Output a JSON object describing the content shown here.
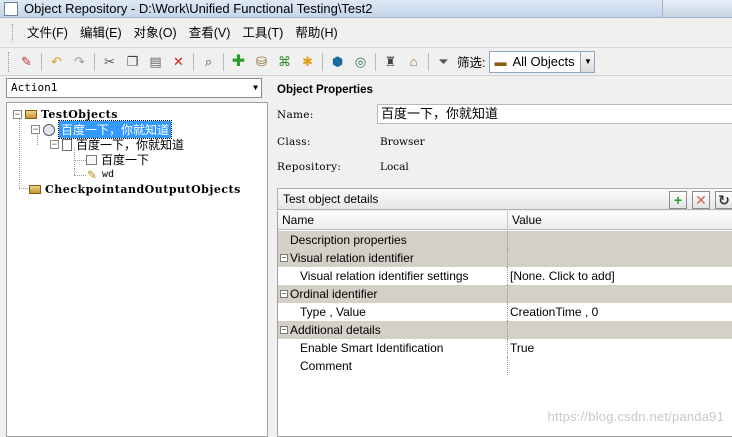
{
  "window": {
    "title": "Object Repository - D:\\Work\\Unified Functional Testing\\Test2"
  },
  "menu": {
    "items": [
      "文件(F)",
      "编辑(E)",
      "对象(O)",
      "查看(V)",
      "工具(T)",
      "帮助(H)"
    ]
  },
  "toolbar": {
    "icons": [
      "locate-icon",
      "undo-icon",
      "redo-icon",
      "cut-icon",
      "copy-icon",
      "paste-icon",
      "delete-icon",
      "find-icon",
      "add-object-icon",
      "add-objects-icon",
      "navigate-learn-icon",
      "highlight-icon",
      "object-spy-icon",
      "define-object-icon",
      "checkpoint-icon",
      "recovery-icon"
    ],
    "filter_label": "筛选:",
    "filter_value": "All Objects"
  },
  "action": {
    "selected": "Action1"
  },
  "tree": {
    "root_label": "TestObjects",
    "browser_label": "百度一下，你就知道",
    "page_label": "百度一下，你就知道",
    "button_label": "百度一下",
    "edit_label": "wd",
    "checkpoints_label": "CheckpointandOutputObjects"
  },
  "properties": {
    "title": "Object Properties",
    "name_label": "Name:",
    "name_value": "百度一下，你就知道",
    "class_label": "Class:",
    "class_value": "Browser",
    "repository_label": "Repository:",
    "repository_value": "Local"
  },
  "details": {
    "title": "Test object details",
    "columns": [
      "Name",
      "Value"
    ],
    "rows": [
      {
        "name": "Description properties",
        "value": "",
        "category": true,
        "expander": ""
      },
      {
        "name": "Visual relation identifier",
        "value": "",
        "category": true,
        "expander": "−"
      },
      {
        "name": "Visual relation identifier settings",
        "value": "[None. Click to add]",
        "category": false,
        "expander": ""
      },
      {
        "name": "Ordinal identifier",
        "value": "",
        "category": true,
        "expander": "−"
      },
      {
        "name": "Type , Value",
        "value": "CreationTime , 0",
        "category": false,
        "expander": ""
      },
      {
        "name": "Additional details",
        "value": "",
        "category": true,
        "expander": "−"
      },
      {
        "name": "Enable Smart Identification",
        "value": "True",
        "category": false,
        "expander": ""
      },
      {
        "name": "Comment",
        "value": "",
        "category": false,
        "expander": ""
      }
    ]
  },
  "watermark": "https://blog.csdn.net/panda91"
}
